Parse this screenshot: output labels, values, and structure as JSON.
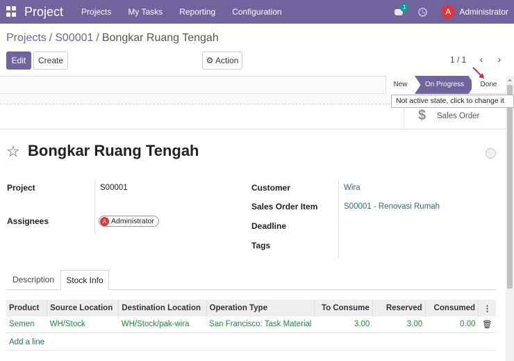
{
  "navbar": {
    "app_title": "Project",
    "menus": [
      "Projects",
      "My Tasks",
      "Reporting",
      "Configuration"
    ],
    "chat_badge": "1",
    "user_initial": "A",
    "user_name": "Administrator",
    "accent_color": "#71639e"
  },
  "breadcrumb": {
    "root": "Projects",
    "parent": "S00001",
    "current": "Bongkar Ruang Tengah"
  },
  "controls": {
    "edit_label": "Edit",
    "create_label": "Create",
    "action_label": "Action",
    "action_icon": "gear-icon",
    "pager": "1 / 1"
  },
  "statusbar": {
    "stages": [
      "New",
      "On Progress",
      "Done"
    ],
    "active_stage": "On Progress",
    "tooltip": "Not active state, click to change it"
  },
  "smart_button": {
    "icon": "dollar-icon",
    "label": "Sales Order"
  },
  "task": {
    "title": "Bongkar Ruang Tengah"
  },
  "fields_left": {
    "project_label": "Project",
    "project_value": "S00001",
    "assignees_label": "Assignees",
    "assignee_initial": "A",
    "assignee_name": "Administrator"
  },
  "fields_right": {
    "customer_label": "Customer",
    "customer_value": "Wira",
    "sale_line_label": "Sales Order Item",
    "sale_line_value": "S00001 - Renovasi Rumah",
    "deadline_label": "Deadline",
    "tags_label": "Tags"
  },
  "tabs": [
    "Description",
    "Stock Info"
  ],
  "active_tab": "Stock Info",
  "table": {
    "columns": [
      "Product",
      "Source Location",
      "Destination Location",
      "Operation Type",
      "To Consume",
      "Reserved",
      "Consumed"
    ],
    "rows": [
      {
        "product": "Semen",
        "source": "WH/Stock",
        "destination": "WH/Stock/pak-wira",
        "operation": "San Francisco: Task Material",
        "to_consume": "3.00",
        "reserved": "3.00",
        "consumed": "0.00"
      }
    ],
    "add_line": "Add a line"
  }
}
